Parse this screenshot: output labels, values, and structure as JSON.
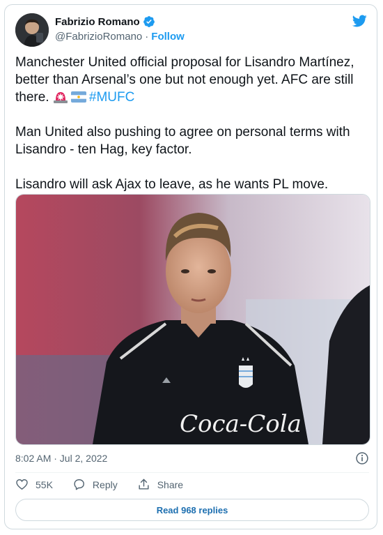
{
  "author": {
    "name": "Fabrizio Romano",
    "handle": "@FabrizioRomano",
    "separator": "·",
    "follow_label": "Follow",
    "verified": true
  },
  "tweet": {
    "paragraph1_text": "Manchester United official proposal for Lisandro Martínez, better than Arsenal’s one but not enough yet. AFC are still there.",
    "hashtag": "#MUFC",
    "emojis": [
      "rotating-light-emoji",
      "argentina-flag-emoji"
    ],
    "paragraph2": "Man United also pushing to agree on personal terms with Lisandro - ten Hag, key factor.",
    "paragraph3": "Lisandro will ask Ajax to leave, as he wants PL move."
  },
  "media": {
    "description_icon": "photo",
    "jersey_sponsor": "Coca-Cola"
  },
  "meta": {
    "timestamp": "8:02 AM · Jul 2, 2022"
  },
  "actions": {
    "like_count": "55K",
    "reply_label": "Reply",
    "share_label": "Share"
  },
  "read_replies_label": "Read 968 replies",
  "colors": {
    "accent": "#1d9bf0",
    "text": "#0f1419",
    "muted": "#536471",
    "border": "#cfd9de"
  }
}
